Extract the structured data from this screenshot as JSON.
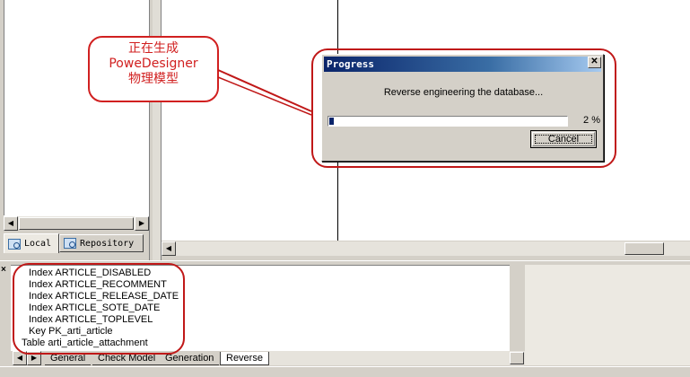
{
  "browser": {
    "tabs": [
      {
        "label": "Local",
        "icon": "local-icon"
      },
      {
        "label": "Repository",
        "icon": "repository-icon"
      }
    ]
  },
  "annotation": {
    "lines": [
      "正在生成",
      "PoweDesigner",
      "物理模型"
    ],
    "color": "#d12020"
  },
  "dialog": {
    "title": "Progress",
    "close_glyph": "✕",
    "message": "Reverse engineering the database...",
    "progress_percent": 2,
    "progress_text": "2 %",
    "cancel_label": "Cancel"
  },
  "output": {
    "lines": [
      "Index ARTICLE_DISABLED",
      "Index ARTICLE_RECOMMENT",
      "Index ARTICLE_RELEASE_DATE",
      "Index ARTICLE_SOTE_DATE",
      "Index ARTICLE_TOPLEVEL",
      "Key PK_arti_article",
      "Table arti_article_attachment"
    ],
    "tabs": [
      "General",
      "Check Model",
      "Generation",
      "Reverse"
    ],
    "active_tab": "Reverse"
  }
}
